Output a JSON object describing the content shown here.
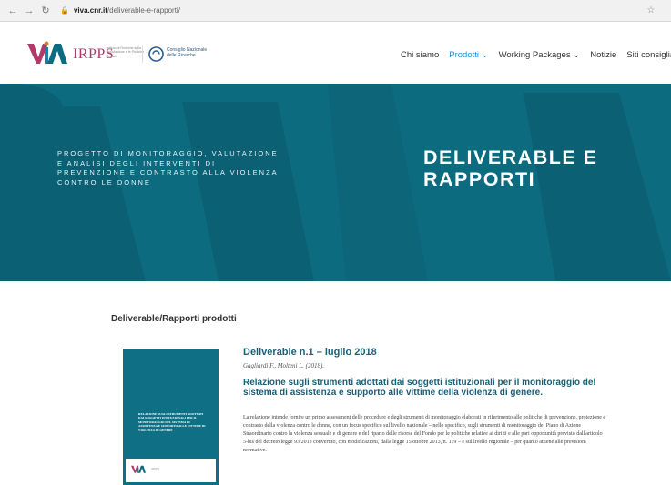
{
  "browser": {
    "url_host": "viva.cnr.it",
    "url_path": "/deliverable-e-rapporti/",
    "back_icon": "arrow-left-icon",
    "forward_icon": "arrow-right-icon",
    "reload_icon": "reload-icon",
    "star_icon": "star-icon"
  },
  "header": {
    "logo_text": "VIVA",
    "irpps_text": "IRPPS",
    "irpps_desc": "Istituto di Ricerche sulla Popolazione e le Politiche Sociali",
    "cnr_text_line1": "Consiglio Nazionale",
    "cnr_text_line2": "delle Ricerche",
    "menu": [
      {
        "label": "Chi siamo"
      },
      {
        "label": "Prodotti ⌄"
      },
      {
        "label": "Working Packages ⌄"
      },
      {
        "label": "Notizie"
      },
      {
        "label": "Siti consigliati"
      }
    ]
  },
  "hero": {
    "subtitle": "PROGETTO DI MONITORAGGIO, VALUTAZIONE E ANALISI DEGLI INTERVENTI DI PREVENZIONE E CONTRASTO ALLA VIOLENZA CONTRO LE DONNE",
    "title": "DELIVERABLE E RAPPORTI"
  },
  "content": {
    "section_title": "Deliverable/Rapporti prodotti",
    "cover_text": "Relazione sugli strumenti adottati dai soggetti istituzionali per il monitoraggio del sistema di assistenza e supporto alle vittime di violenza di genere",
    "deliverable_title": "Deliverable n.1 – luglio 2018",
    "authors": "Gagliardi F., Molteni L. (2018).",
    "report_title": "Relazione sugli strumenti adottati dai soggetti istituzionali per il monitoraggio del sistema di assistenza e supporto alle vittime della violenza di genere.",
    "abstract": "La relazione intende fornire un primo assessment delle procedure e degli strumenti di monitoraggio elaborati in riferimento alle politiche di prevenzione, protezione e contrasto della violenza contro le donne, con un focus specifico sul livello nazionale – nello specifico, sugli strumenti di monitoraggio del Piano di Azione Straordinario contro la violenza sessuale e di genere e del riparto delle risorse del Fondo per le politiche relative ai diritti e alle pari opportunità previsto dall'articolo 5-bis del decreto legge 93/2013 convertito, con modificazioni, dalla legge 15 ottobre 2013, n. 119 – e sul livello regionale – per quanto attiene alle previsioni normative."
  },
  "colors": {
    "hero_bg": "#0d6b80",
    "accent": "#1e8fc9",
    "heading": "#1a5f78",
    "irpps": "#b03a6b"
  }
}
